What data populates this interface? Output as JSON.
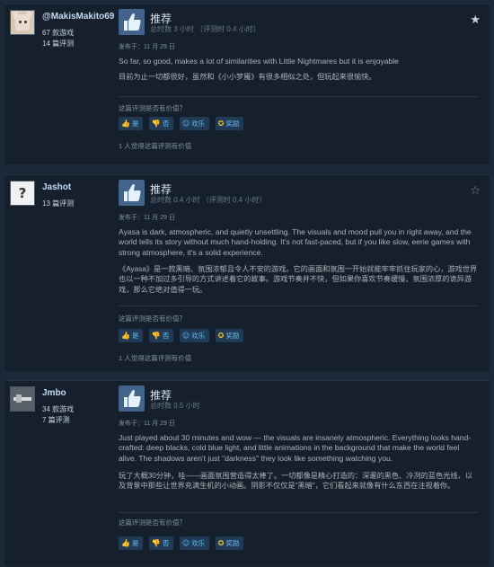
{
  "labels": {
    "verdict": "推荐",
    "helpful_question": "这篇评测是否有价值？",
    "yes": "是",
    "no": "否",
    "funny": "欢乐",
    "award": "奖励"
  },
  "colors": {
    "background": "#1b2838",
    "card": "#16202d",
    "thumb_tile": "#42648a",
    "button_bg": "#213a55",
    "link_blue": "#66c0f4",
    "award_gold": "#f5c518"
  },
  "reviews": [
    {
      "author": "@MakisMakito69",
      "games": "67 款游戏",
      "reviews": "14 篇评测",
      "hours": "总时数 3 小时 （评测时 0.4 小时）",
      "posted": "发布于：11 月 29 日",
      "text_en": "So far, so good, makes a lot of similarities with Little Nightmares but it is enjoyable",
      "text_cn": "目前为止一切都很好，虽然和《小小梦魇》有很多相似之处，但玩起来很愉快。",
      "helpful_count": "1 人觉得这篇评测有价值",
      "starred": true,
      "avatar_icon": "cat-avatar-icon"
    },
    {
      "author": "Jashot",
      "games": "",
      "reviews": "13 篇评测",
      "hours": "总时数 0.4 小时 （评测时 0.4 小时）",
      "posted": "发布于：11 月 29 日",
      "text_en": "Ayasa is dark, atmospheric, and quietly unsettling. The visuals and mood pull you in right away, and the world tells its story without much hand-holding. It's not fast-paced, but if you like slow, eerie games with strong atmosphere, it's a solid experience.",
      "text_cn": "《Ayasa》是一款黑暗、氛围浓郁且令人不安的游戏。它的画面和氛围一开始就能牢牢抓住玩家的心，游戏世界也以一种不加过多引导的方式讲述着它的故事。游戏节奏并不快，但如果你喜欢节奏缓慢、氛围浓厚的诡异游戏，那么它绝对值得一玩。",
      "helpful_count": "1 人觉得这篇评测有价值",
      "starred": false,
      "avatar_icon": "question-mark-avatar-icon"
    },
    {
      "author": "Jmbo",
      "games": "34 款游戏",
      "reviews": "7 篇评测",
      "hours": "总时数 0.5 小时",
      "posted": "发布于：11 月 29 日",
      "text_en": "Just played about 30 minutes and wow — the visuals are insanely atmospheric. Everything looks hand-crafted: deep blacks, cold blue light, and little animations in the background that make the world feel alive. The shadows aren't just \"darkness\" they look like something watching you.",
      "text_cn": "玩了大概30分钟，哇——画面氛围营造得太棒了。一切都像是精心打造的：深邃的黑色、冷冽的蓝色光线，以及背景中那些让世界充满生机的小动画。阴影不仅仅是\"黑暗\"，它们看起来就像有什么东西在注视着你。",
      "helpful_count": "",
      "starred": false,
      "avatar_icon": "gray-avatar-icon"
    }
  ]
}
